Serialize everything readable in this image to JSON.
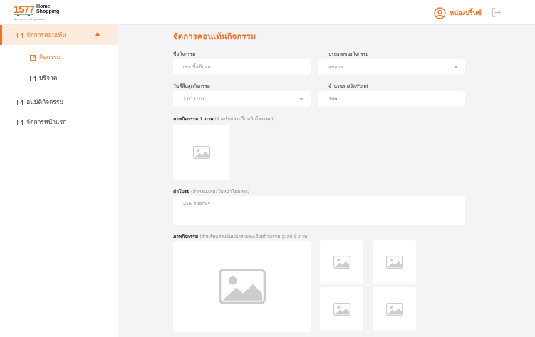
{
  "header": {
    "logo_number": "1577",
    "logo_title_line1": "Home",
    "logo_title_line2": "Shopping",
    "logo_tagline": "We serve with passion",
    "user_name": "หน่องปริ้นซ์"
  },
  "sidebar": {
    "items": [
      {
        "label": "จัดการคอนเท้น",
        "icon": "edit-icon",
        "active": true,
        "expanded": true
      },
      {
        "label": "กิจกรรม",
        "icon": "edit-icon",
        "active": true,
        "sub": true
      },
      {
        "label": "บริจาค",
        "icon": "edit-icon",
        "sub": true
      },
      {
        "label": "อนุมัติกิจกรรม",
        "icon": "edit-icon"
      },
      {
        "label": "จัดการหน้าแรก",
        "icon": "edit-icon"
      }
    ]
  },
  "form": {
    "title": "จัดการคอนเท้นกิจกรรม",
    "activity_name_label": "ชื่อกิจกรรม",
    "activity_name_placeholder": "เช่น ชิ้นบีนสุด",
    "activity_type_label": "ประเภทของกิจกรรม",
    "activity_type_value": "สุขภาพ",
    "end_date_label": "วันที่สิ้นสุดกิจกรรม",
    "end_date_value": "22/11/20",
    "points_label": "จำนวนรางวัล/Point",
    "points_value": "100",
    "cover_label": "ภาพกิจกรรม 1 ภาพ",
    "cover_hint": "(สำหรับแสดงในหน้าโฮมเพจ)",
    "promo_label": "คำโปรย",
    "promo_hint": "(สำหรับแสดงในหน้าโฮมเพจ)",
    "promo_placeholder": "255 ตัวอักษร",
    "gallery_label": "ภาพกิจกรรม",
    "gallery_hint": "(สำหรับแสดงในหน้ารายละเอียดกิจกรรม สูงสุด 5 ภาพ)"
  },
  "colors": {
    "accent": "#f36f21",
    "active_bg": "#fdebdd",
    "page_bg": "#f4f4f6"
  }
}
